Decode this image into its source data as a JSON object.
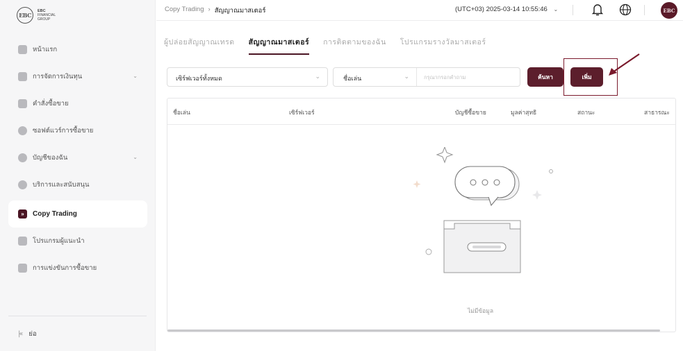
{
  "brand": {
    "logo_mark": "EBC",
    "line1": "EBC",
    "line2": "FINANCIAL",
    "line3": "GROUP"
  },
  "sidebar": {
    "items": [
      {
        "label": "หน้าแรก",
        "icon": "home-icon",
        "has_children": false,
        "active": false
      },
      {
        "label": "การจัดการเงินทุน",
        "icon": "wallet-icon",
        "has_children": true,
        "active": false
      },
      {
        "label": "คำสั่งซื้อขาย",
        "icon": "chart-icon",
        "has_children": false,
        "active": false
      },
      {
        "label": "ซอฟต์แวร์การซื้อขาย",
        "icon": "software-icon",
        "has_children": false,
        "active": false
      },
      {
        "label": "บัญชีของฉัน",
        "icon": "user-icon",
        "has_children": true,
        "active": false
      },
      {
        "label": "บริการและสนับสนุน",
        "icon": "help-icon",
        "has_children": false,
        "active": false
      },
      {
        "label": "Copy Trading",
        "icon": "copy-trading-icon",
        "has_children": false,
        "active": true
      },
      {
        "label": "โปรแกรมผู้แนะนำ",
        "icon": "referral-icon",
        "has_children": false,
        "active": false
      },
      {
        "label": "การแข่งขันการซื้อขาย",
        "icon": "trophy-icon",
        "has_children": false,
        "active": false
      }
    ],
    "collapse_label": "ย่อ"
  },
  "topbar": {
    "breadcrumb_root": "Copy Trading",
    "breadcrumb_current": "สัญญาณมาสเตอร์",
    "timezone": "(UTC+03)",
    "datetime": "2025-03-14 10:55:46"
  },
  "tabs": [
    {
      "label": "ผู้ปล่อยสัญญาณเทรด",
      "active": false
    },
    {
      "label": "สัญญาณมาสเตอร์",
      "active": true
    },
    {
      "label": "การติดตามของฉัน",
      "active": false
    },
    {
      "label": "โปรแกรมรางวัลมาสเตอร์",
      "active": false
    }
  ],
  "filters": {
    "server_select": "เซิร์ฟเวอร์ทั้งหมด",
    "field_select": "ชื่อเล่น",
    "search_placeholder": "กรุณากรอกคำถาม",
    "search_button": "ค้นหา",
    "add_button": "เพิ่ม"
  },
  "table": {
    "columns": [
      "ชื่อเล่น",
      "เซิร์ฟเวอร์",
      "บัญชีซื้อขาย",
      "มูลค่าสุทธิ",
      "สถานะ",
      "สาธารณะ"
    ],
    "rows": [],
    "empty_text": "ไม่มีข้อมูล"
  },
  "colors": {
    "accent": "#5c1e2c",
    "annotation": "#7a1a2c"
  }
}
